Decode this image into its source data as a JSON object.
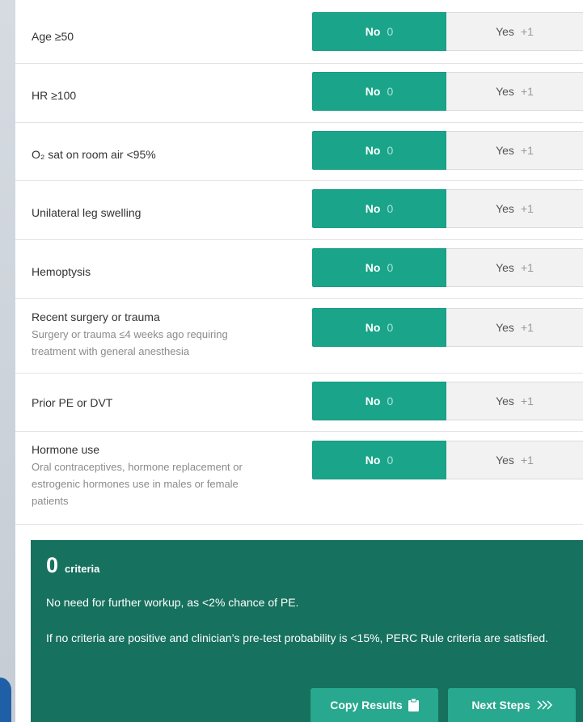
{
  "criteria": [
    {
      "label": "Age ≥50",
      "sub": ""
    },
    {
      "label": "HR ≥100",
      "sub": ""
    },
    {
      "label": "O₂ sat on room air <95%",
      "sub": ""
    },
    {
      "label": "Unilateral leg swelling",
      "sub": ""
    },
    {
      "label": "Hemoptysis",
      "sub": ""
    },
    {
      "label": "Recent surgery or trauma",
      "sub": "Surgery or trauma ≤4 weeks ago requiring treatment with general anesthesia"
    },
    {
      "label": "Prior PE or DVT",
      "sub": ""
    },
    {
      "label": "Hormone use",
      "sub": "Oral contraceptives, hormone replacement or estrogenic hormones use in males or female patients"
    }
  ],
  "options": {
    "no_label": "No",
    "no_points": "0",
    "yes_label": "Yes",
    "yes_points": "+1"
  },
  "result": {
    "score": "0",
    "unit": "criteria",
    "line1": "No need for further workup, as <2% chance of PE.",
    "line2": "If no criteria are positive and clinician’s pre-test probability is <15%, PERC Rule criteria are satisfied.",
    "copy_label": "Copy Results",
    "next_label": "Next Steps"
  },
  "icons": {
    "copy": "clipboard-icon",
    "next": "chevron-double-right-icon"
  },
  "colors": {
    "selected": "#1aa58a",
    "result_bg": "#16715e",
    "button_bg": "#28a88e"
  }
}
